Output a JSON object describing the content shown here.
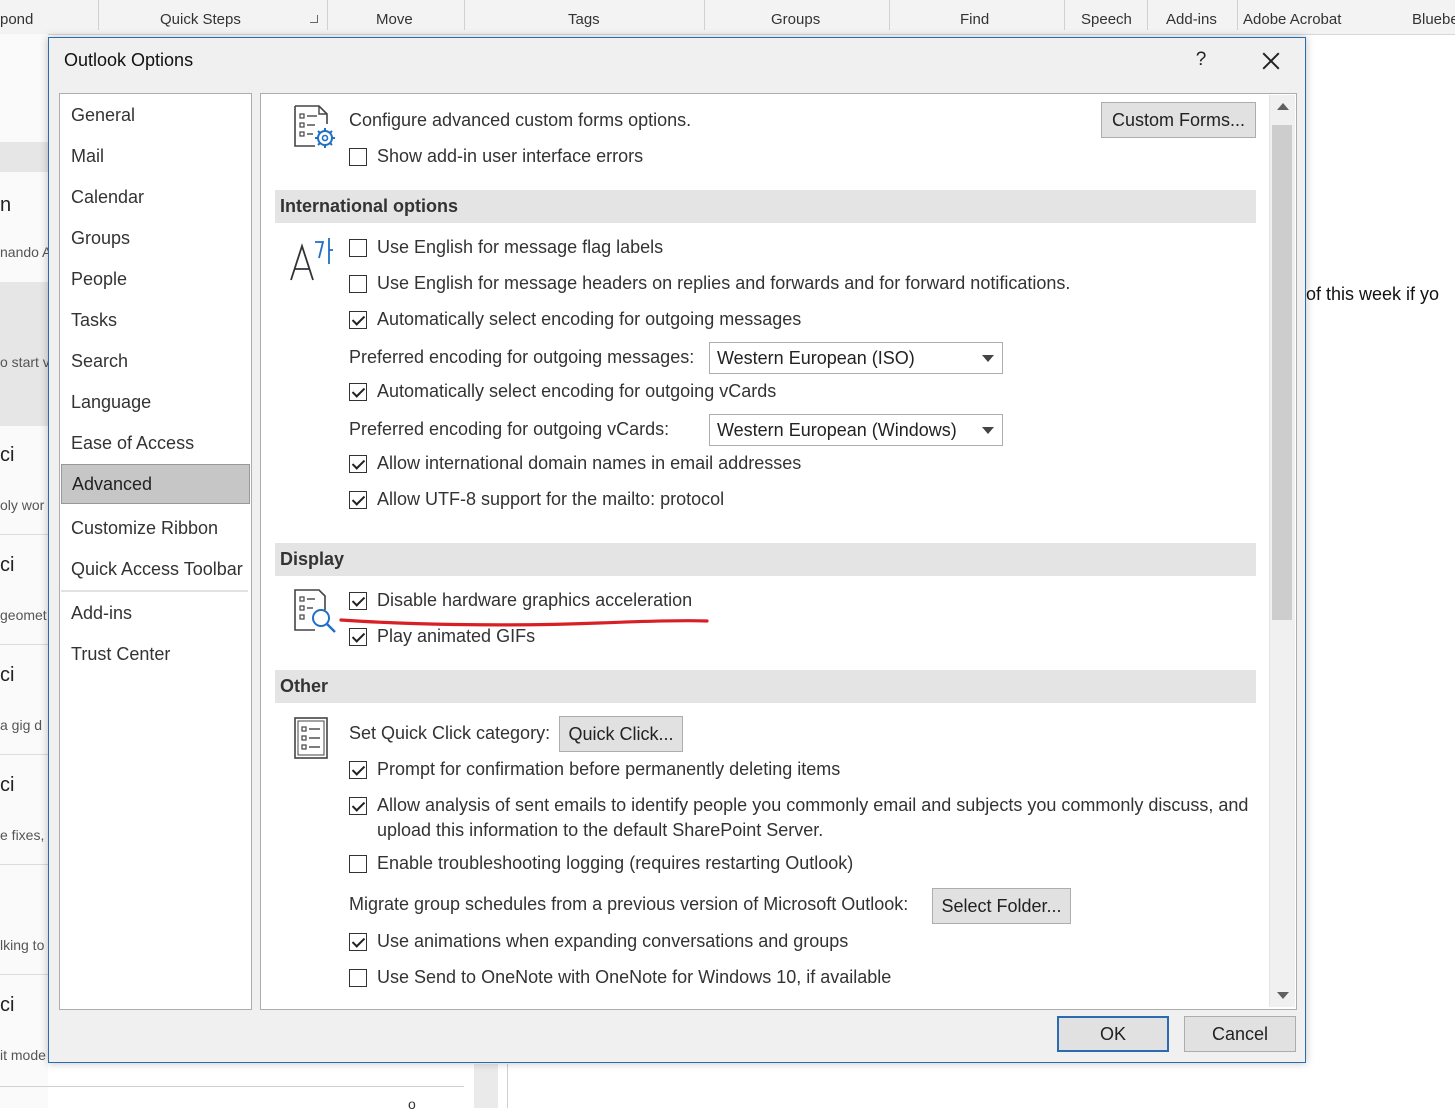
{
  "ribbon": {
    "groups": [
      "pond",
      "Quick Steps",
      "Move",
      "Tags",
      "Groups",
      "Find",
      "Speech",
      "Add-ins",
      "Adobe Acrobat",
      "Bluebe"
    ]
  },
  "background": {
    "left_fragments": [
      "n",
      "nando A",
      "o start v",
      "ci",
      "oly wor",
      "ci",
      "geomet",
      "ci",
      "a gig d",
      "ci",
      "e fixes, l",
      "lking to",
      "ci",
      "it mode"
    ],
    "message_preview": "of this week if yo",
    "misc_glyph": "o"
  },
  "dialog": {
    "title": "Outlook Options",
    "help_label": "?",
    "ok_label": "OK",
    "cancel_label": "Cancel"
  },
  "nav": {
    "items": [
      "General",
      "Mail",
      "Calendar",
      "Groups",
      "People",
      "Tasks",
      "Search",
      "Language",
      "Ease of Access",
      "Advanced",
      "Customize Ribbon",
      "Quick Access Toolbar",
      "Add-ins",
      "Trust Center"
    ],
    "selected": "Advanced"
  },
  "forms": {
    "description": "Configure advanced custom forms options.",
    "custom_forms_button": "Custom Forms...",
    "show_addin_errors": {
      "label": "Show add-in user interface errors",
      "checked": false
    }
  },
  "international": {
    "heading": "International options",
    "flag_labels": {
      "label": "Use English for message flag labels",
      "checked": false
    },
    "message_headers": {
      "label": "Use English for message headers on replies and forwards and for forward notifications.",
      "checked": false
    },
    "auto_encoding": {
      "label": "Automatically select encoding for outgoing messages",
      "checked": true
    },
    "preferred_encoding_label": "Preferred encoding for outgoing messages:",
    "preferred_encoding_value": "Western European (ISO)",
    "auto_vcards": {
      "label": "Automatically select encoding for outgoing vCards",
      "checked": true
    },
    "preferred_vcards_label": "Preferred encoding for outgoing vCards:",
    "preferred_vcards_value": "Western European (Windows)",
    "intl_domain": {
      "label": "Allow international domain names in email addresses",
      "checked": true
    },
    "utf8": {
      "label": "Allow UTF-8 support for the mailto: protocol",
      "checked": true
    }
  },
  "display": {
    "heading": "Display",
    "disable_hw": {
      "label": "Disable hardware graphics acceleration",
      "checked": true
    },
    "animated_gifs": {
      "label": "Play animated GIFs",
      "checked": true
    },
    "annotation_color": "#d81f26"
  },
  "other": {
    "heading": "Other",
    "quick_click_label": "Set Quick Click category:",
    "quick_click_button": "Quick Click...",
    "prompt_delete": {
      "label": "Prompt for confirmation before permanently deleting items",
      "checked": true
    },
    "analysis": {
      "label_line1": "Allow analysis of sent emails to identify people you commonly email and subjects you commonly discuss, and",
      "label_line2": "upload this information to the default SharePoint Server.",
      "checked": true
    },
    "troubleshooting": {
      "label": "Enable troubleshooting logging (requires restarting Outlook)",
      "checked": false
    },
    "migrate_label": "Migrate group schedules from a previous version of Microsoft Outlook:",
    "select_folder_button": "Select Folder...",
    "animations": {
      "label": "Use animations when expanding conversations and groups",
      "checked": true
    },
    "onenote": {
      "label": "Use Send to OneNote with OneNote for Windows 10, if available",
      "checked": false
    }
  },
  "colors": {
    "accent": "#2b6cb0",
    "selected_nav": "#c6c6c6",
    "section_header": "#e4e4e4"
  }
}
